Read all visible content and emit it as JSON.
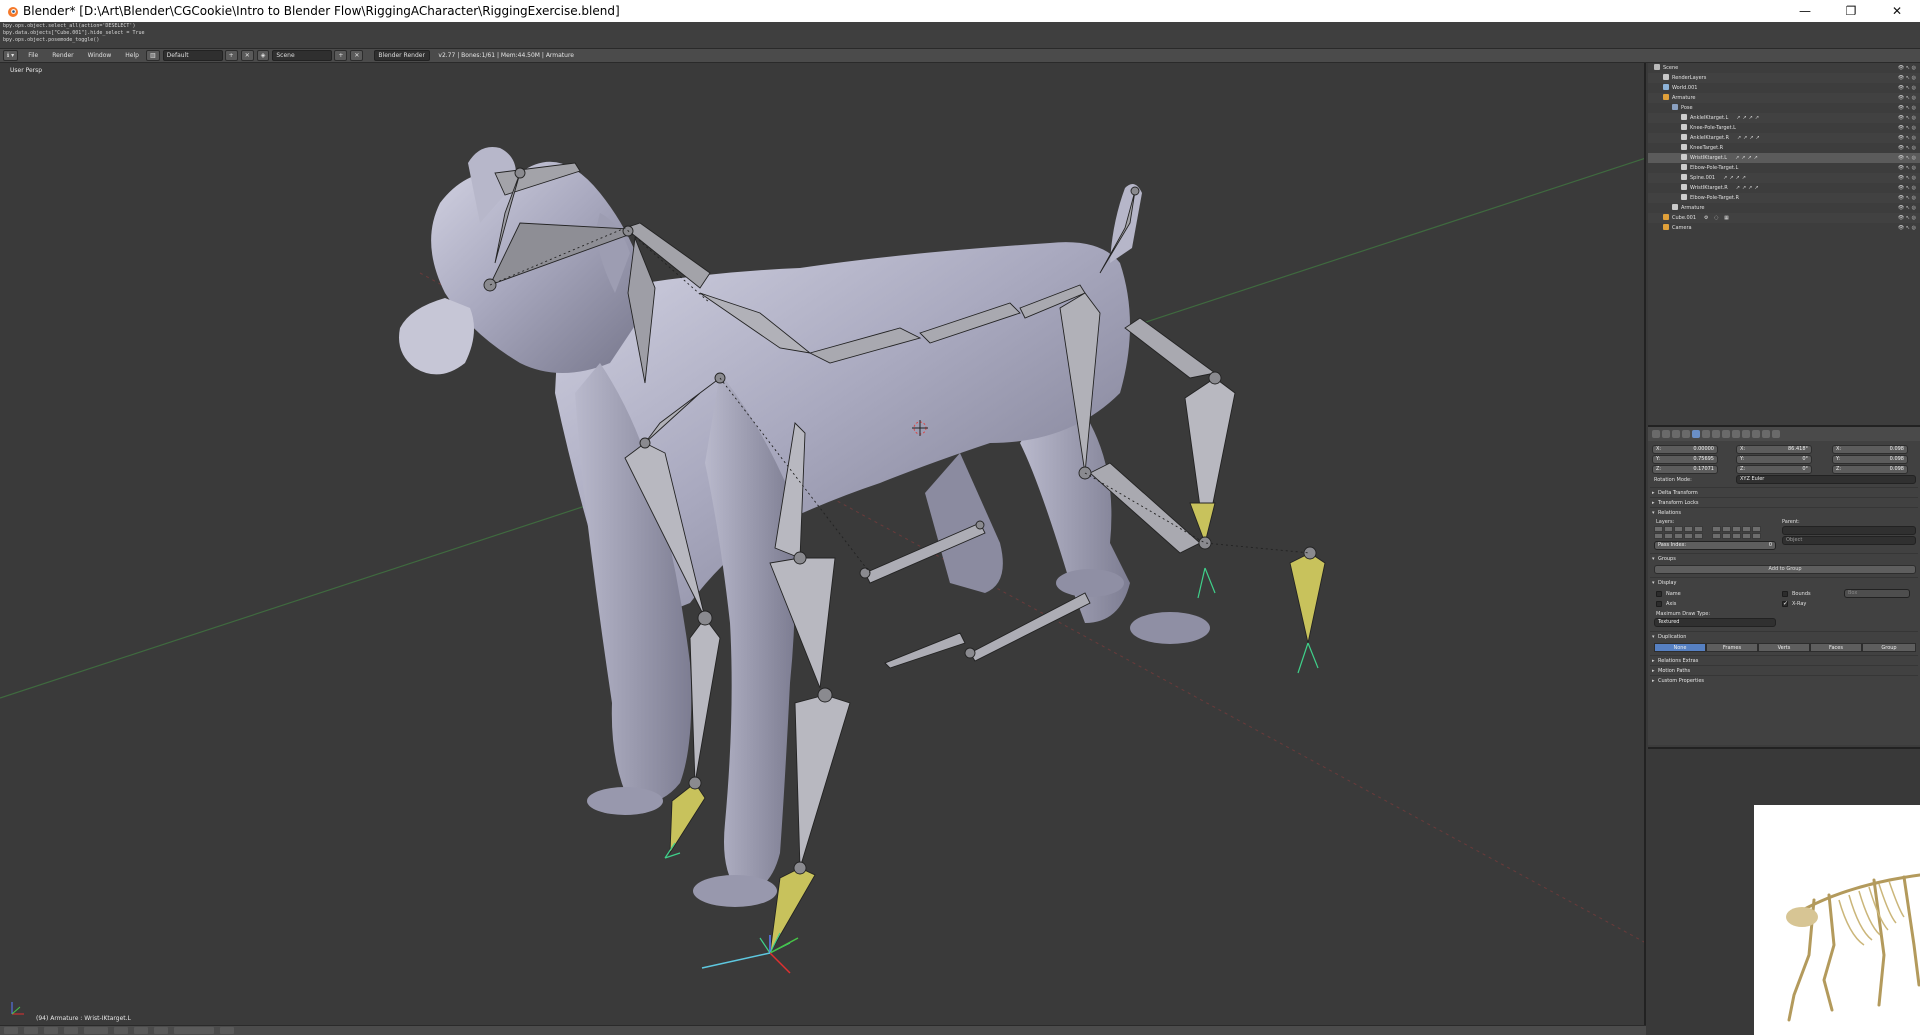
{
  "window": {
    "title": "Blender* [D:\\Art\\Blender\\CGCookie\\Intro to Blender Flow\\RiggingACharacter\\RiggingExercise.blend]",
    "minimize": "—",
    "maximize": "❐",
    "close": "✕"
  },
  "console": {
    "lines": [
      "bpy.ops.object.select_all(action='DESELECT')",
      "bpy.data.objects[\"Cube.001\"].hide_select = True",
      "bpy.ops.object.posemode_toggle()"
    ]
  },
  "info_header": {
    "menus": [
      "File",
      "Render",
      "Window",
      "Help"
    ],
    "screen_layout": "Default",
    "scene": "Scene",
    "render_engine": "Blender Render",
    "stats": "v2.77 | Bones:1/61 | Mem:44.50M | Armature"
  },
  "viewport": {
    "view_label": "User Persp",
    "object_info": "(94) Armature : Wrist-IKtarget.L"
  },
  "outliner": {
    "rows": [
      {
        "label": "Scene",
        "indent": 0,
        "icon_color": "#b9b9b9"
      },
      {
        "label": "RenderLayers",
        "indent": 1,
        "icon_color": "#c7c7c7"
      },
      {
        "label": "World.001",
        "indent": 1,
        "icon_color": "#8cb2d8"
      },
      {
        "label": "Armature",
        "indent": 1,
        "icon_color": "#e0a03a"
      },
      {
        "label": "Pose",
        "indent": 2,
        "icon_color": "#8aa0c0"
      },
      {
        "label": "AnkleIKtarget.L",
        "indent": 3,
        "icon_color": "#cccccc",
        "cons": "↗↗↗↗"
      },
      {
        "label": "Knee-Pole-Target.L",
        "indent": 3,
        "icon_color": "#cccccc",
        "cons": ""
      },
      {
        "label": "AnkleIKtarget.R",
        "indent": 3,
        "icon_color": "#cccccc",
        "cons": "↗↗↗↗"
      },
      {
        "label": "KneeTarget.R",
        "indent": 3,
        "icon_color": "#cccccc",
        "cons": ""
      },
      {
        "label": "WristIKtarget.L",
        "indent": 3,
        "icon_color": "#cccccc",
        "cons": "↗↗↗↗",
        "selected": true
      },
      {
        "label": "Elbow-Pole-Target.L",
        "indent": 3,
        "icon_color": "#cccccc",
        "cons": ""
      },
      {
        "label": "Spine.001",
        "indent": 3,
        "icon_color": "#cccccc",
        "cons": "↗↗↗↗"
      },
      {
        "label": "WristIKtarget.R",
        "indent": 3,
        "icon_color": "#cccccc",
        "cons": "↗↗↗↗"
      },
      {
        "label": "Elbow-Pole-Target.R",
        "indent": 3,
        "icon_color": "#cccccc",
        "cons": ""
      },
      {
        "label": "Armature",
        "indent": 2,
        "icon_color": "#c8c8c8"
      },
      {
        "label": "Cube.001",
        "indent": 1,
        "icon_color": "#e0a03a",
        "cons": "⚙ ◌ ▦"
      },
      {
        "label": "Camera",
        "indent": 1,
        "icon_color": "#e0a03a"
      }
    ]
  },
  "properties": {
    "location": {
      "x": "0.00000",
      "y": "0.75695",
      "z": "0.17071"
    },
    "rotation": {
      "x": "86.418°",
      "y": "0°",
      "z": "0°"
    },
    "scale": {
      "x": "0.098",
      "y": "0.098",
      "z": "0.098"
    },
    "rotation_mode_label": "Rotation Mode:",
    "rotation_mode": "XYZ Euler",
    "panels": {
      "delta": "Delta Transform",
      "transform_locks": "Transform Locks",
      "relations": "Relations",
      "groups": "Groups",
      "display": "Display",
      "duplication": "Duplication",
      "relations_extras": "Relations Extras",
      "motion_paths": "Motion Paths",
      "custom_props": "Custom Properties"
    },
    "layers_label": "Layers:",
    "parent_label": "Parent:",
    "parent_value": "",
    "parent_type": "Object",
    "pass_index": "Pass Index:",
    "pass_index_value": "0",
    "add_to_group": "Add to Group",
    "display": {
      "name": "Name",
      "axis": "Axis",
      "bounds": "Bounds",
      "bounds_type": "Box",
      "xray": "X-Ray",
      "max_draw_type_label": "Maximum Draw Type:",
      "max_draw_type": "Textured"
    },
    "duplication_options": [
      "None",
      "Frames",
      "Verts",
      "Faces",
      "Group"
    ]
  },
  "colors": {
    "viewport_bg": "#3a3a3a",
    "bone": "#a3a3a9",
    "ik_bone": "#c8c25c",
    "selection_blue": "#5680c2"
  }
}
